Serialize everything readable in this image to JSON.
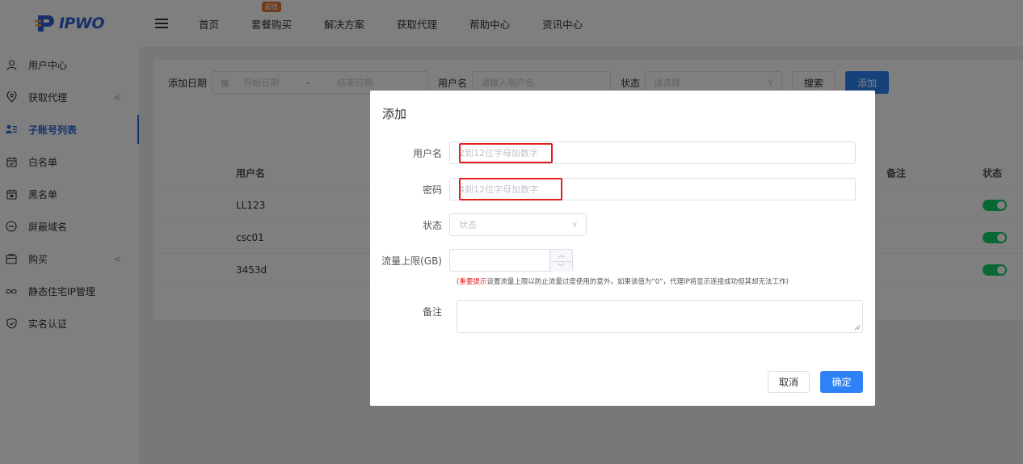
{
  "brand": {
    "name": "IPWO",
    "color": "#2f61d6"
  },
  "sidebar": {
    "items": [
      {
        "label": "用户中心",
        "icon": "user-icon",
        "has_arrow": false,
        "active": false
      },
      {
        "label": "获取代理",
        "icon": "location-pin-icon",
        "has_arrow": true,
        "active": false
      },
      {
        "label": "子账号列表",
        "icon": "sub-account-list-icon",
        "has_arrow": false,
        "active": true
      },
      {
        "label": "白名单",
        "icon": "calendar-check-icon",
        "has_arrow": false,
        "active": false
      },
      {
        "label": "黑名单",
        "icon": "calendar-block-icon",
        "has_arrow": false,
        "active": false
      },
      {
        "label": "屏蔽域名",
        "icon": "minus-circle-icon",
        "has_arrow": false,
        "active": false
      },
      {
        "label": "购买",
        "icon": "wallet-icon",
        "has_arrow": true,
        "active": false
      },
      {
        "label": "静态住宅IP管理",
        "icon": "infinity-icon",
        "has_arrow": false,
        "active": false
      },
      {
        "label": "实名认证",
        "icon": "shield-check-icon",
        "has_arrow": false,
        "active": false
      }
    ],
    "arrow_glyph": "<"
  },
  "topbar": {
    "nav": [
      {
        "label": "首页",
        "badge": ""
      },
      {
        "label": "套餐购买",
        "badge": "超值"
      },
      {
        "label": "解决方案",
        "badge": ""
      },
      {
        "label": "获取代理",
        "badge": ""
      },
      {
        "label": "帮助中心",
        "badge": ""
      },
      {
        "label": "资讯中心",
        "badge": ""
      }
    ]
  },
  "filters": {
    "date_label": "添加日期",
    "start_placeholder": "开始日期",
    "range_sep": "-",
    "end_placeholder": "结束日期",
    "username_label": "用户名",
    "username_placeholder": "请输入用户名",
    "status_label": "状态",
    "status_placeholder": "请选择",
    "search_button": "搜索",
    "add_button": "添加"
  },
  "table": {
    "headers": {
      "username": "用户名",
      "remark": "备注",
      "status": "状态"
    },
    "rows": [
      {
        "username": "LL123",
        "enabled": true
      },
      {
        "username": "csc01",
        "enabled": true
      },
      {
        "username": "3453d",
        "enabled": true
      }
    ]
  },
  "modal": {
    "title": "添加",
    "username_label": "用户名",
    "username_placeholder": "2到12位字母加数字",
    "password_label": "密码",
    "password_placeholder": "4到12位字母加数字",
    "status_label": "状态",
    "status_placeholder": "状态",
    "traffic_label": "流量上限(GB)",
    "traffic_value": "",
    "hint_prefix": "(重要提示",
    "hint_text": "设置流量上限以防止流量过度使用的意外。如果该值为“0”，代理IP将显示连接成功但其却无法工作)",
    "remark_label": "备注",
    "cancel_button": "取消",
    "confirm_button": "确定"
  },
  "colors": {
    "primary": "#2f82f6",
    "accent_active": "#2b6cd8",
    "toggle_on": "#13ce66",
    "highlight": "#e0211f"
  }
}
